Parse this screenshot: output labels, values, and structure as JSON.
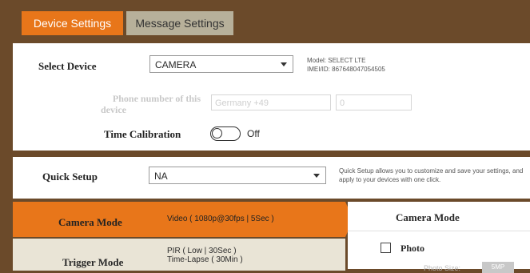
{
  "tabs": [
    {
      "label": "Device Settings",
      "active": true
    },
    {
      "label": "Message Settings",
      "active": false
    }
  ],
  "device": {
    "select_label": "Select Device",
    "selected": "CAMERA",
    "model_line": "Model: SELECT LTE",
    "imei_line": "IMEI/ID: 867648047054505"
  },
  "phone": {
    "label_line1": "Phone number of this",
    "label_line2": "device",
    "country": "Germany +49",
    "number": "0"
  },
  "time_calibration": {
    "label": "Time Calibration",
    "state": "Off"
  },
  "quick_setup": {
    "label": "Quick Setup",
    "selected": "NA",
    "help_line1": "Quick Setup allows you to customize and save your settings, and",
    "help_line2": "apply to your devices with one click."
  },
  "modes": [
    {
      "name": "Camera Mode",
      "value_line1": "Video  ( 1080p@30fps  |  5Sec )",
      "value_line2": "",
      "active": true
    },
    {
      "name": "Trigger Mode",
      "value_line1": "PIR  ( Low  |  30Sec )",
      "value_line2": "Time-Lapse  ( 30Min )",
      "active": false
    }
  ],
  "camera_panel": {
    "title": "Camera Mode",
    "photo_label": "Photo",
    "photo_size_label": "Photo Size:",
    "size_option": "5MP"
  },
  "colors": {
    "accent": "#e8761a",
    "background": "#6b4a2a",
    "inactive_tab": "#b7b09a"
  }
}
